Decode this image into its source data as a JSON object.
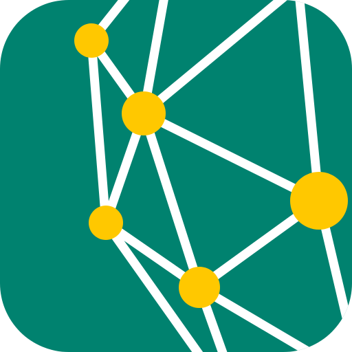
{
  "app_icon": {
    "icon_name": "network-graph-icon",
    "colors": {
      "tile": "#00826F",
      "edge": "#FFFFFF",
      "node": "#FFC800"
    }
  }
}
